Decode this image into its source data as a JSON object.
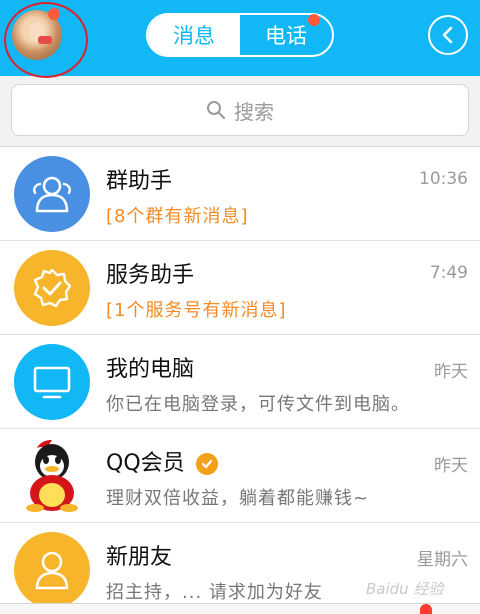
{
  "header": {
    "tabs": [
      {
        "label": "消息",
        "active": true
      },
      {
        "label": "电话",
        "active": false
      }
    ],
    "accent_color": "#12b7f5",
    "badge_color": "#ff5a3c"
  },
  "search": {
    "placeholder": "搜索"
  },
  "conversations": [
    {
      "title": "群助手",
      "subtitle": "[8个群有新消息]",
      "time": "10:36",
      "icon": "group-icon",
      "color": "#4a90e2"
    },
    {
      "title": "服务助手",
      "subtitle": "[1个服务号有新消息]",
      "time": "7:49",
      "icon": "badge-check-icon",
      "color": "#f7b52c"
    },
    {
      "title": "我的电脑",
      "subtitle": "你已在电脑登录，可传文件到电脑。",
      "time": "昨天",
      "icon": "monitor-icon",
      "color": "#12b7f5"
    },
    {
      "title": "QQ会员",
      "subtitle": "理财双倍收益，躺着都能赚钱~",
      "time": "昨天",
      "icon": "qq-penguin-icon"
    },
    {
      "title": "新朋友",
      "subtitle": "招主持，... 请求加为好友",
      "time": "星期六",
      "icon": "person-icon",
      "color": "#f7b52c"
    }
  ],
  "watermark": "Baidu 经验"
}
